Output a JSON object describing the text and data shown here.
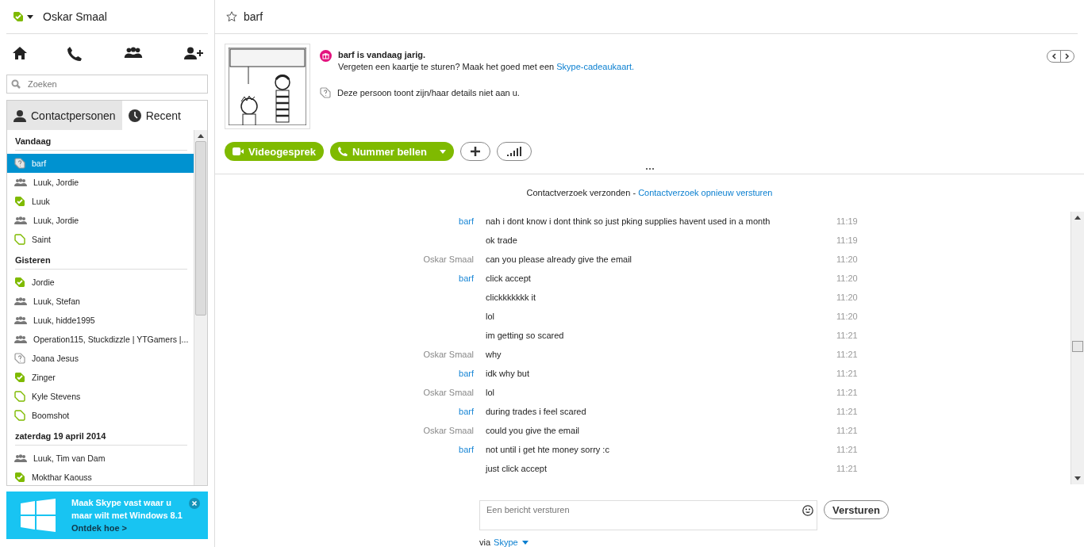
{
  "account": {
    "name": "Oskar Smaal"
  },
  "search": {
    "placeholder": "Zoeken"
  },
  "tabs": [
    {
      "label": "Contactpersonen",
      "selected": true
    },
    {
      "label": "Recent",
      "selected": false
    }
  ],
  "recent": [
    {
      "heading": "Vandaag",
      "items": [
        {
          "name": "barf",
          "kind": "unknown",
          "selected": true
        },
        {
          "name": "Luuk, Jordie",
          "kind": "group",
          "selected": false
        },
        {
          "name": "Luuk",
          "kind": "online",
          "selected": false
        },
        {
          "name": "Luuk, Jordie",
          "kind": "group",
          "selected": false
        },
        {
          "name": "Saint",
          "kind": "offline",
          "selected": false
        }
      ]
    },
    {
      "heading": "Gisteren",
      "items": [
        {
          "name": "Jordie",
          "kind": "online",
          "selected": false
        },
        {
          "name": "Luuk, Stefan",
          "kind": "group",
          "selected": false
        },
        {
          "name": "Luuk, hidde1995",
          "kind": "group",
          "selected": false
        },
        {
          "name": "Operation115, Stuckdizzle | YTGamers |...",
          "kind": "group",
          "selected": false
        },
        {
          "name": "Joana Jesus",
          "kind": "unknown",
          "selected": false
        },
        {
          "name": "Zinger",
          "kind": "online",
          "selected": false
        },
        {
          "name": "Kyle Stevens",
          "kind": "offline",
          "selected": false
        },
        {
          "name": "Boomshot",
          "kind": "offline",
          "selected": false
        }
      ]
    },
    {
      "heading": "zaterdag 19 april 2014",
      "items": [
        {
          "name": "Luuk, Tim van Dam",
          "kind": "group",
          "selected": false
        },
        {
          "name": "Mokthar Kaouss",
          "kind": "online",
          "selected": false
        }
      ]
    }
  ],
  "banner": {
    "lines": [
      "Maak Skype vast waar u",
      "maar wilt met Windows 8.1"
    ],
    "link": "Ontdek hoe >"
  },
  "conversation": {
    "title": "barf",
    "birthday": {
      "title": "barf is vandaag jarig.",
      "text": "Vergeten een kaartje te sturen? Maak het goed met een ",
      "link": "Skype-cadeaukaart."
    },
    "privacy": "Deze persoon toont zijn/haar details niet aan u.",
    "buttons": [
      {
        "label": "Videogesprek",
        "kind": "video"
      },
      {
        "label": "Nummer bellen",
        "kind": "call"
      },
      {
        "kind": "add"
      },
      {
        "kind": "signal"
      }
    ],
    "request": {
      "text": "Contactverzoek verzonden - ",
      "link": "Contactverzoek opnieuw versturen"
    },
    "messages": [
      {
        "sender": "barf",
        "color": "#1a87d6",
        "text": "nah i dont know i dont think so just pking supplies havent used in a month",
        "time": "11:19"
      },
      {
        "text": "ok trade",
        "time": "11:19"
      },
      {
        "sender": "Oskar Smaal",
        "color": "#888888",
        "text": "can you please already give the email",
        "time": "11:20"
      },
      {
        "sender": "barf",
        "color": "#1a87d6",
        "text": "click accept",
        "time": "11:20"
      },
      {
        "text": "clickkkkkkk it",
        "time": "11:20"
      },
      {
        "text": "lol",
        "time": "11:20"
      },
      {
        "text": "im getting so scared",
        "time": "11:21"
      },
      {
        "sender": "Oskar Smaal",
        "color": "#888888",
        "text": "why",
        "time": "11:21"
      },
      {
        "sender": "barf",
        "color": "#1a87d6",
        "text": "idk why but",
        "time": "11:21"
      },
      {
        "sender": "Oskar Smaal",
        "color": "#888888",
        "text": "lol",
        "time": "11:21"
      },
      {
        "sender": "barf",
        "color": "#1a87d6",
        "text": "during trades i feel scared",
        "time": "11:21"
      },
      {
        "sender": "Oskar Smaal",
        "color": "#888888",
        "text": "could you give the email",
        "time": "11:21"
      },
      {
        "sender": "barf",
        "color": "#1a87d6",
        "text": "not until i get hte money sorry :c",
        "time": "11:21"
      },
      {
        "text": "just click accept",
        "time": "11:21"
      }
    ],
    "composer": {
      "placeholder": "Een bericht versturen",
      "send": "Versturen",
      "via": "via ",
      "service": "Skype"
    }
  }
}
